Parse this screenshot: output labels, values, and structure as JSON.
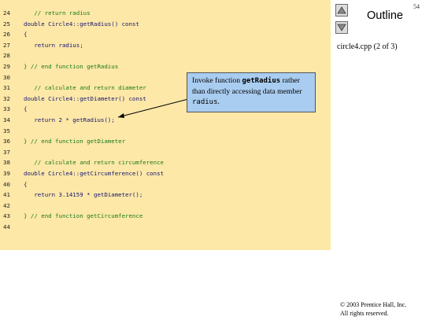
{
  "code_lines": [
    {
      "num": "24",
      "text": "   // return radius",
      "type": "comment"
    },
    {
      "num": "25",
      "text": "double Circle4::getRadius() const",
      "type": "code"
    },
    {
      "num": "26",
      "text": "{",
      "type": "code"
    },
    {
      "num": "27",
      "text": "   return radius;",
      "type": "code"
    },
    {
      "num": "28",
      "text": "",
      "type": "code"
    },
    {
      "num": "29",
      "text": "} // end function getRadius",
      "type": "comment"
    },
    {
      "num": "30",
      "text": "",
      "type": "code"
    },
    {
      "num": "31",
      "text": "   // calculate and return diameter",
      "type": "comment"
    },
    {
      "num": "32",
      "text": "double Circle4::getDiameter() const",
      "type": "code"
    },
    {
      "num": "33",
      "text": "{",
      "type": "code"
    },
    {
      "num": "34",
      "text": "   return 2 * getRadius();",
      "type": "code"
    },
    {
      "num": "35",
      "text": "",
      "type": "code"
    },
    {
      "num": "36",
      "text": "} // end function getDiameter",
      "type": "comment"
    },
    {
      "num": "37",
      "text": "",
      "type": "code"
    },
    {
      "num": "38",
      "text": "   // calculate and return circumference",
      "type": "comment"
    },
    {
      "num": "39",
      "text": "double Circle4::getCircumference() const",
      "type": "code"
    },
    {
      "num": "40",
      "text": "{",
      "type": "code"
    },
    {
      "num": "41",
      "text": "   return 3.14159 * getDiameter();",
      "type": "code"
    },
    {
      "num": "42",
      "text": "",
      "type": "code"
    },
    {
      "num": "43",
      "text": "} // end function getCircumference",
      "type": "comment"
    },
    {
      "num": "44",
      "text": "",
      "type": "code"
    }
  ],
  "callout": {
    "part1": "Invoke function ",
    "code1": "getRadius",
    "part2": "rather than directly accessing data member ",
    "code2": "radius",
    "part3": "."
  },
  "sidebar": {
    "page_number": "54",
    "outline_title": "Outline",
    "file_label": "circle4.cpp (2 of 3)",
    "up_icon": "up-arrow-icon",
    "down_icon": "down-arrow-icon"
  },
  "footer": {
    "copyright_line1": "© 2003 Prentice Hall, Inc.",
    "copyright_line2": "All rights reserved."
  },
  "colors": {
    "code_panel_bg": "#fde8a8",
    "code_text": "#14146e",
    "comment_text": "#1a7a1a",
    "callout_bg": "#a9cdf0"
  }
}
